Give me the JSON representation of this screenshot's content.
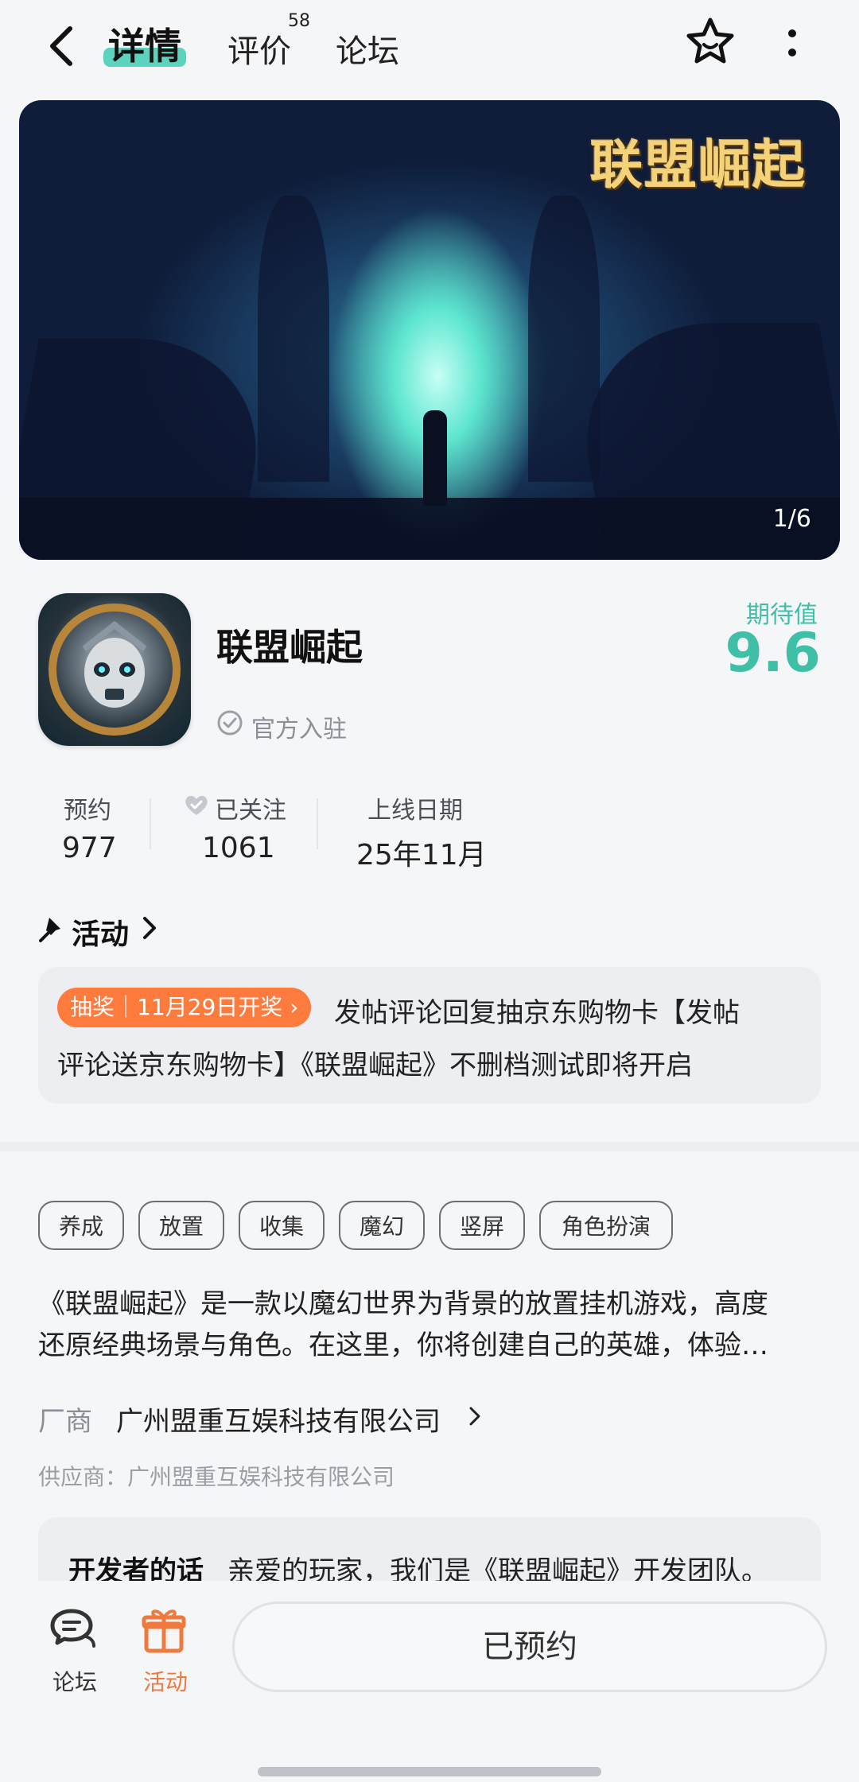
{
  "nav": {
    "tabs": [
      {
        "label": "详情",
        "active": true
      },
      {
        "label": "评价",
        "badge": "58"
      },
      {
        "label": "论坛"
      }
    ]
  },
  "banner": {
    "logo_text": "联盟崛起",
    "counter": "1/6"
  },
  "app": {
    "name": "联盟崛起",
    "verified_text": "官方入驻",
    "expect_label": "期待值",
    "expect_score": "9.6",
    "accent_color": "#3fbfa6"
  },
  "stats": [
    {
      "label": "预约",
      "value": "977"
    },
    {
      "label": "已关注",
      "value": "1061"
    },
    {
      "label": "上线日期",
      "value": "25年11月"
    }
  ],
  "activity": {
    "title": "活动",
    "badge": "抽奖｜11月29日开奖",
    "line1": "发帖评论回复抽京东购物卡【发帖",
    "line2": "评论送京东购物卡】《联盟崛起》不删档测试即将开启",
    "badge_color": "#ff7a3d"
  },
  "tags": [
    "养成",
    "放置",
    "收集",
    "魔幻",
    "竖屏",
    "角色扮演"
  ],
  "description": {
    "line1": "《联盟崛起》是一款以魔幻世界为背景的放置挂机游戏，高度",
    "line2": "还原经典场景与角色。在这里，你将创建自己的英雄，体验…"
  },
  "vendor": {
    "label": "厂商",
    "name": "广州盟重互娱科技有限公司",
    "supplier": "供应商：广州盟重互娱科技有限公司"
  },
  "developer": {
    "title": "开发者的话",
    "text": "亲爱的玩家，我们是《联盟崛起》开发团队。"
  },
  "bottom": {
    "forum_label": "论坛",
    "activity_label": "活动",
    "reserve_label": "已预约"
  }
}
